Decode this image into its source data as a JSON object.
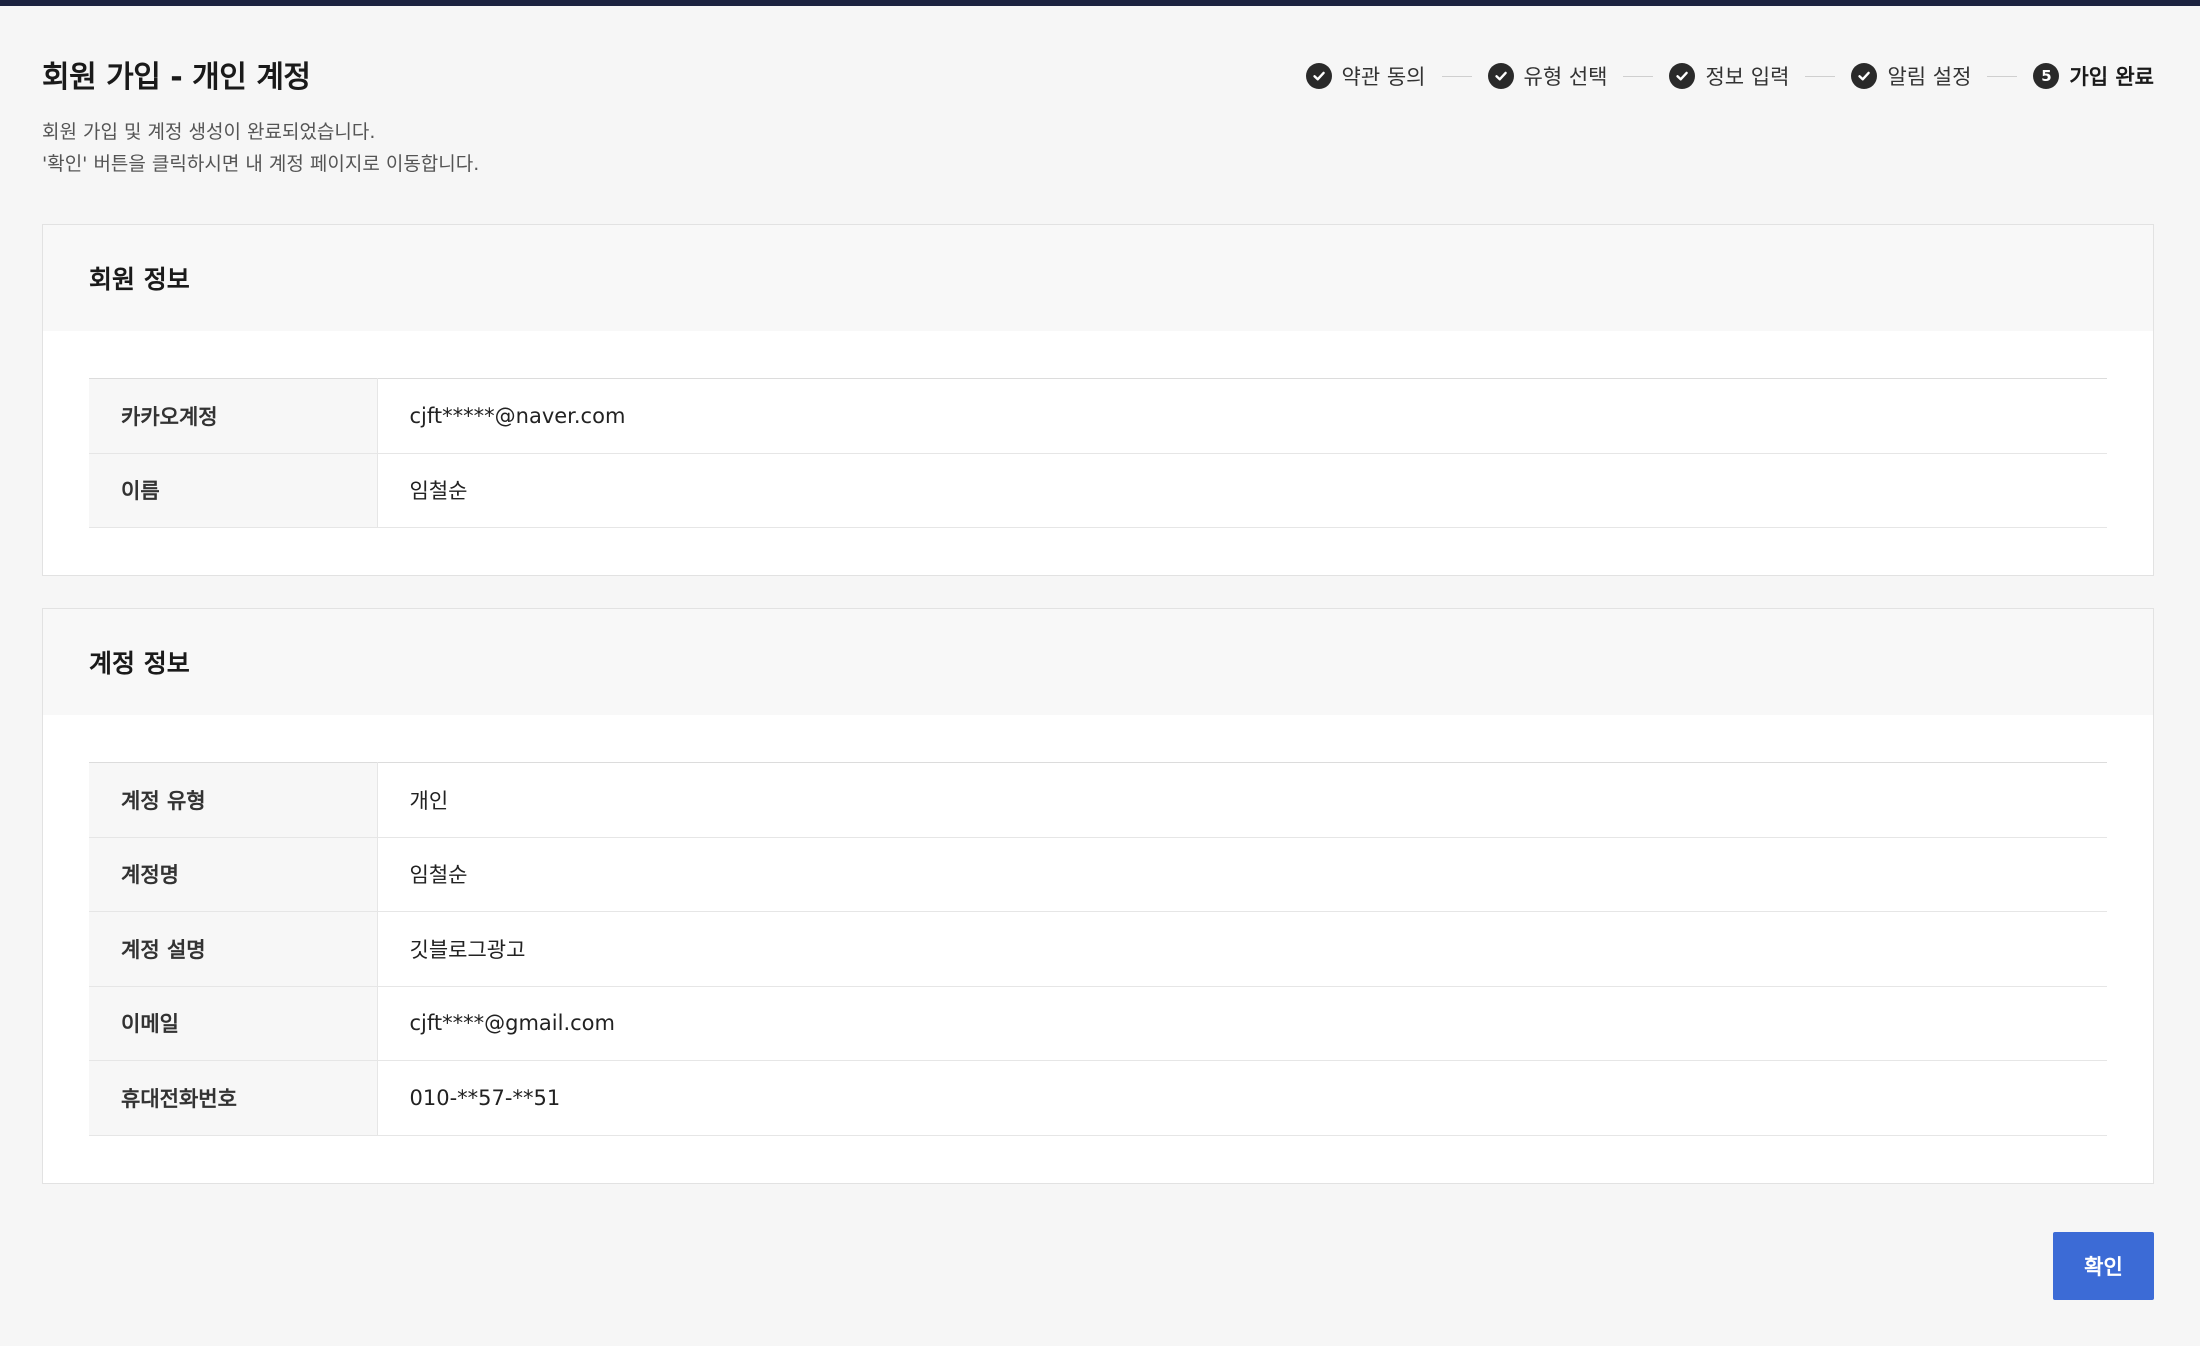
{
  "header": {
    "title": "회원 가입 - 개인 계정",
    "desc_line1": "회원 가입 및 계정 생성이 완료되었습니다.",
    "desc_line2": "'확인' 버튼을 클릭하시면 내 계정 페이지로 이동합니다."
  },
  "steps": [
    {
      "label": "약관 동의",
      "state": "done"
    },
    {
      "label": "유형 선택",
      "state": "done"
    },
    {
      "label": "정보 입력",
      "state": "done"
    },
    {
      "label": "알림 설정",
      "state": "done"
    },
    {
      "label": "가입 완료",
      "number": "5",
      "state": "current"
    }
  ],
  "member_info": {
    "title": "회원 정보",
    "rows": [
      {
        "key": "카카오계정",
        "value": "cjft*****@naver.com"
      },
      {
        "key": "이름",
        "value": "임철순"
      }
    ]
  },
  "account_info": {
    "title": "계정 정보",
    "rows": [
      {
        "key": "계정 유형",
        "value": "개인"
      },
      {
        "key": "계정명",
        "value": "임철순"
      },
      {
        "key": "계정 설명",
        "value": "깃블로그광고"
      },
      {
        "key": "이메일",
        "value": "cjft****@gmail.com"
      },
      {
        "key": "휴대전화번호",
        "value": "010-**57-**51"
      }
    ]
  },
  "footer": {
    "confirm_label": "확인"
  },
  "colors": {
    "accent": "#3c6bd6",
    "topbar": "#1c2340",
    "step_circle": "#2a2a2a"
  }
}
